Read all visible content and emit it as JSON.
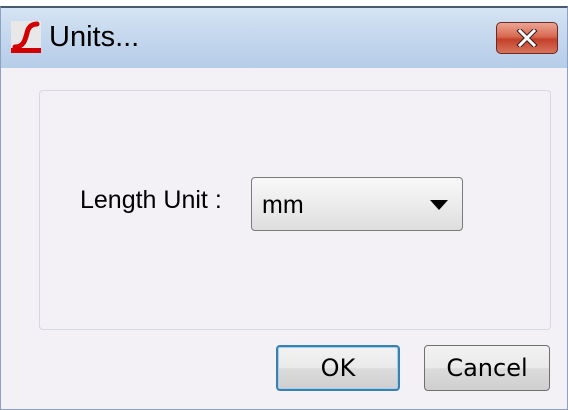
{
  "window": {
    "title": "Units...",
    "icon": "app-logo-icon",
    "close_icon": "close-icon"
  },
  "form": {
    "length_label": "Length Unit :",
    "length_unit_value": "mm"
  },
  "buttons": {
    "ok_label": "OK",
    "cancel_label": "Cancel"
  },
  "colors": {
    "titlebar": "#c5d8ee",
    "close_button": "#d86a52",
    "dialog_background": "#f3f1f5",
    "default_button_border": "#3c7fb1"
  }
}
